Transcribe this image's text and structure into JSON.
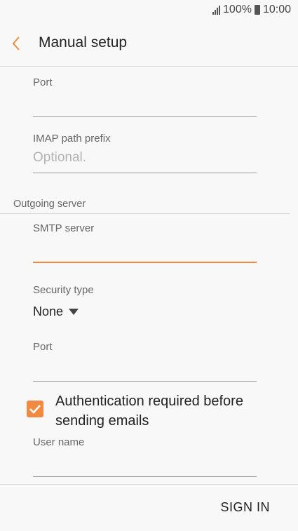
{
  "status": {
    "battery": "100%",
    "time": "10:00"
  },
  "header": {
    "title": "Manual setup",
    "back_icon": "chevron-left-icon"
  },
  "incoming": {
    "port_label": "Port",
    "port_value": "",
    "imap_prefix_label": "IMAP path prefix",
    "imap_prefix_placeholder": "Optional."
  },
  "outgoing": {
    "section_title": "Outgoing server",
    "smtp_label": "SMTP server",
    "smtp_value": "",
    "security_label": "Security type",
    "security_value": "None",
    "port_label": "Port",
    "port_value": "",
    "auth_label": "Authentication required before sending emails",
    "auth_checked": true,
    "username_label": "User name",
    "username_value": ""
  },
  "footer": {
    "sign_in_label": "SIGN IN"
  },
  "colors": {
    "accent": "#F08A43",
    "background": "#F8F8F8",
    "text": "#222222",
    "muted": "#666666"
  }
}
